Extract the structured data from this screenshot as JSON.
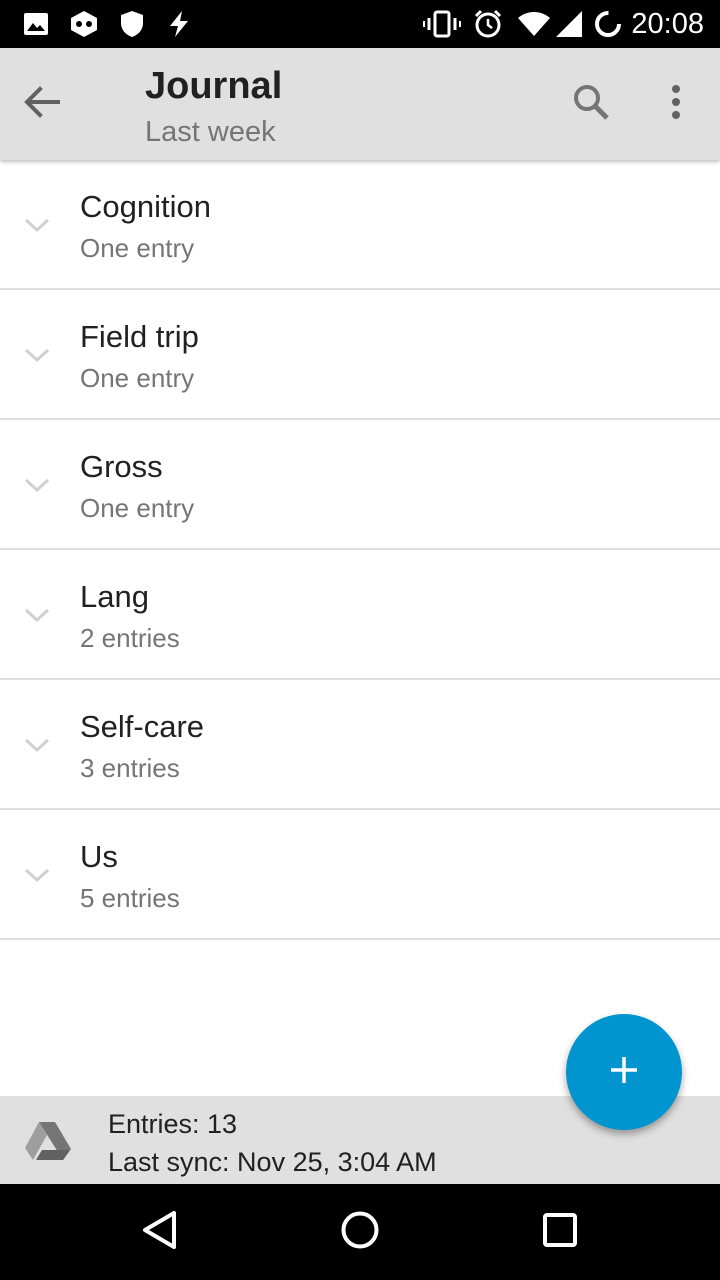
{
  "status_bar": {
    "time": "20:08",
    "icons": [
      "image-notification-icon",
      "game-notification-icon",
      "shield-icon",
      "flash-icon",
      "vibrate-icon",
      "alarm-icon",
      "wifi-icon",
      "signal-icon",
      "battery-icon"
    ]
  },
  "app_bar": {
    "title": "Journal",
    "subtitle": "Last week",
    "actions": [
      "back-arrow-icon",
      "search-icon",
      "more-vert-icon"
    ]
  },
  "categories": [
    {
      "title": "Cognition",
      "count": "One entry"
    },
    {
      "title": "Field trip",
      "count": "One entry"
    },
    {
      "title": "Gross",
      "count": "One entry"
    },
    {
      "title": "Lang",
      "count": "2 entries"
    },
    {
      "title": "Self-care",
      "count": "3 entries"
    },
    {
      "title": "Us",
      "count": "5 entries"
    }
  ],
  "footer": {
    "entries": "Entries: 13",
    "last_sync": "Last sync: Nov 25, 3:04 AM",
    "icon": "drive-icon"
  },
  "fab": {
    "icon": "plus-icon"
  },
  "nav_bar": {
    "icons": [
      "back-triangle-icon",
      "home-circle-icon",
      "recents-square-icon"
    ]
  },
  "colors": {
    "accent": "#0195d0",
    "app_bar": "#e0e0e0",
    "footer": "#e0e0e0",
    "text_primary": "#212121",
    "text_secondary": "#757575"
  }
}
